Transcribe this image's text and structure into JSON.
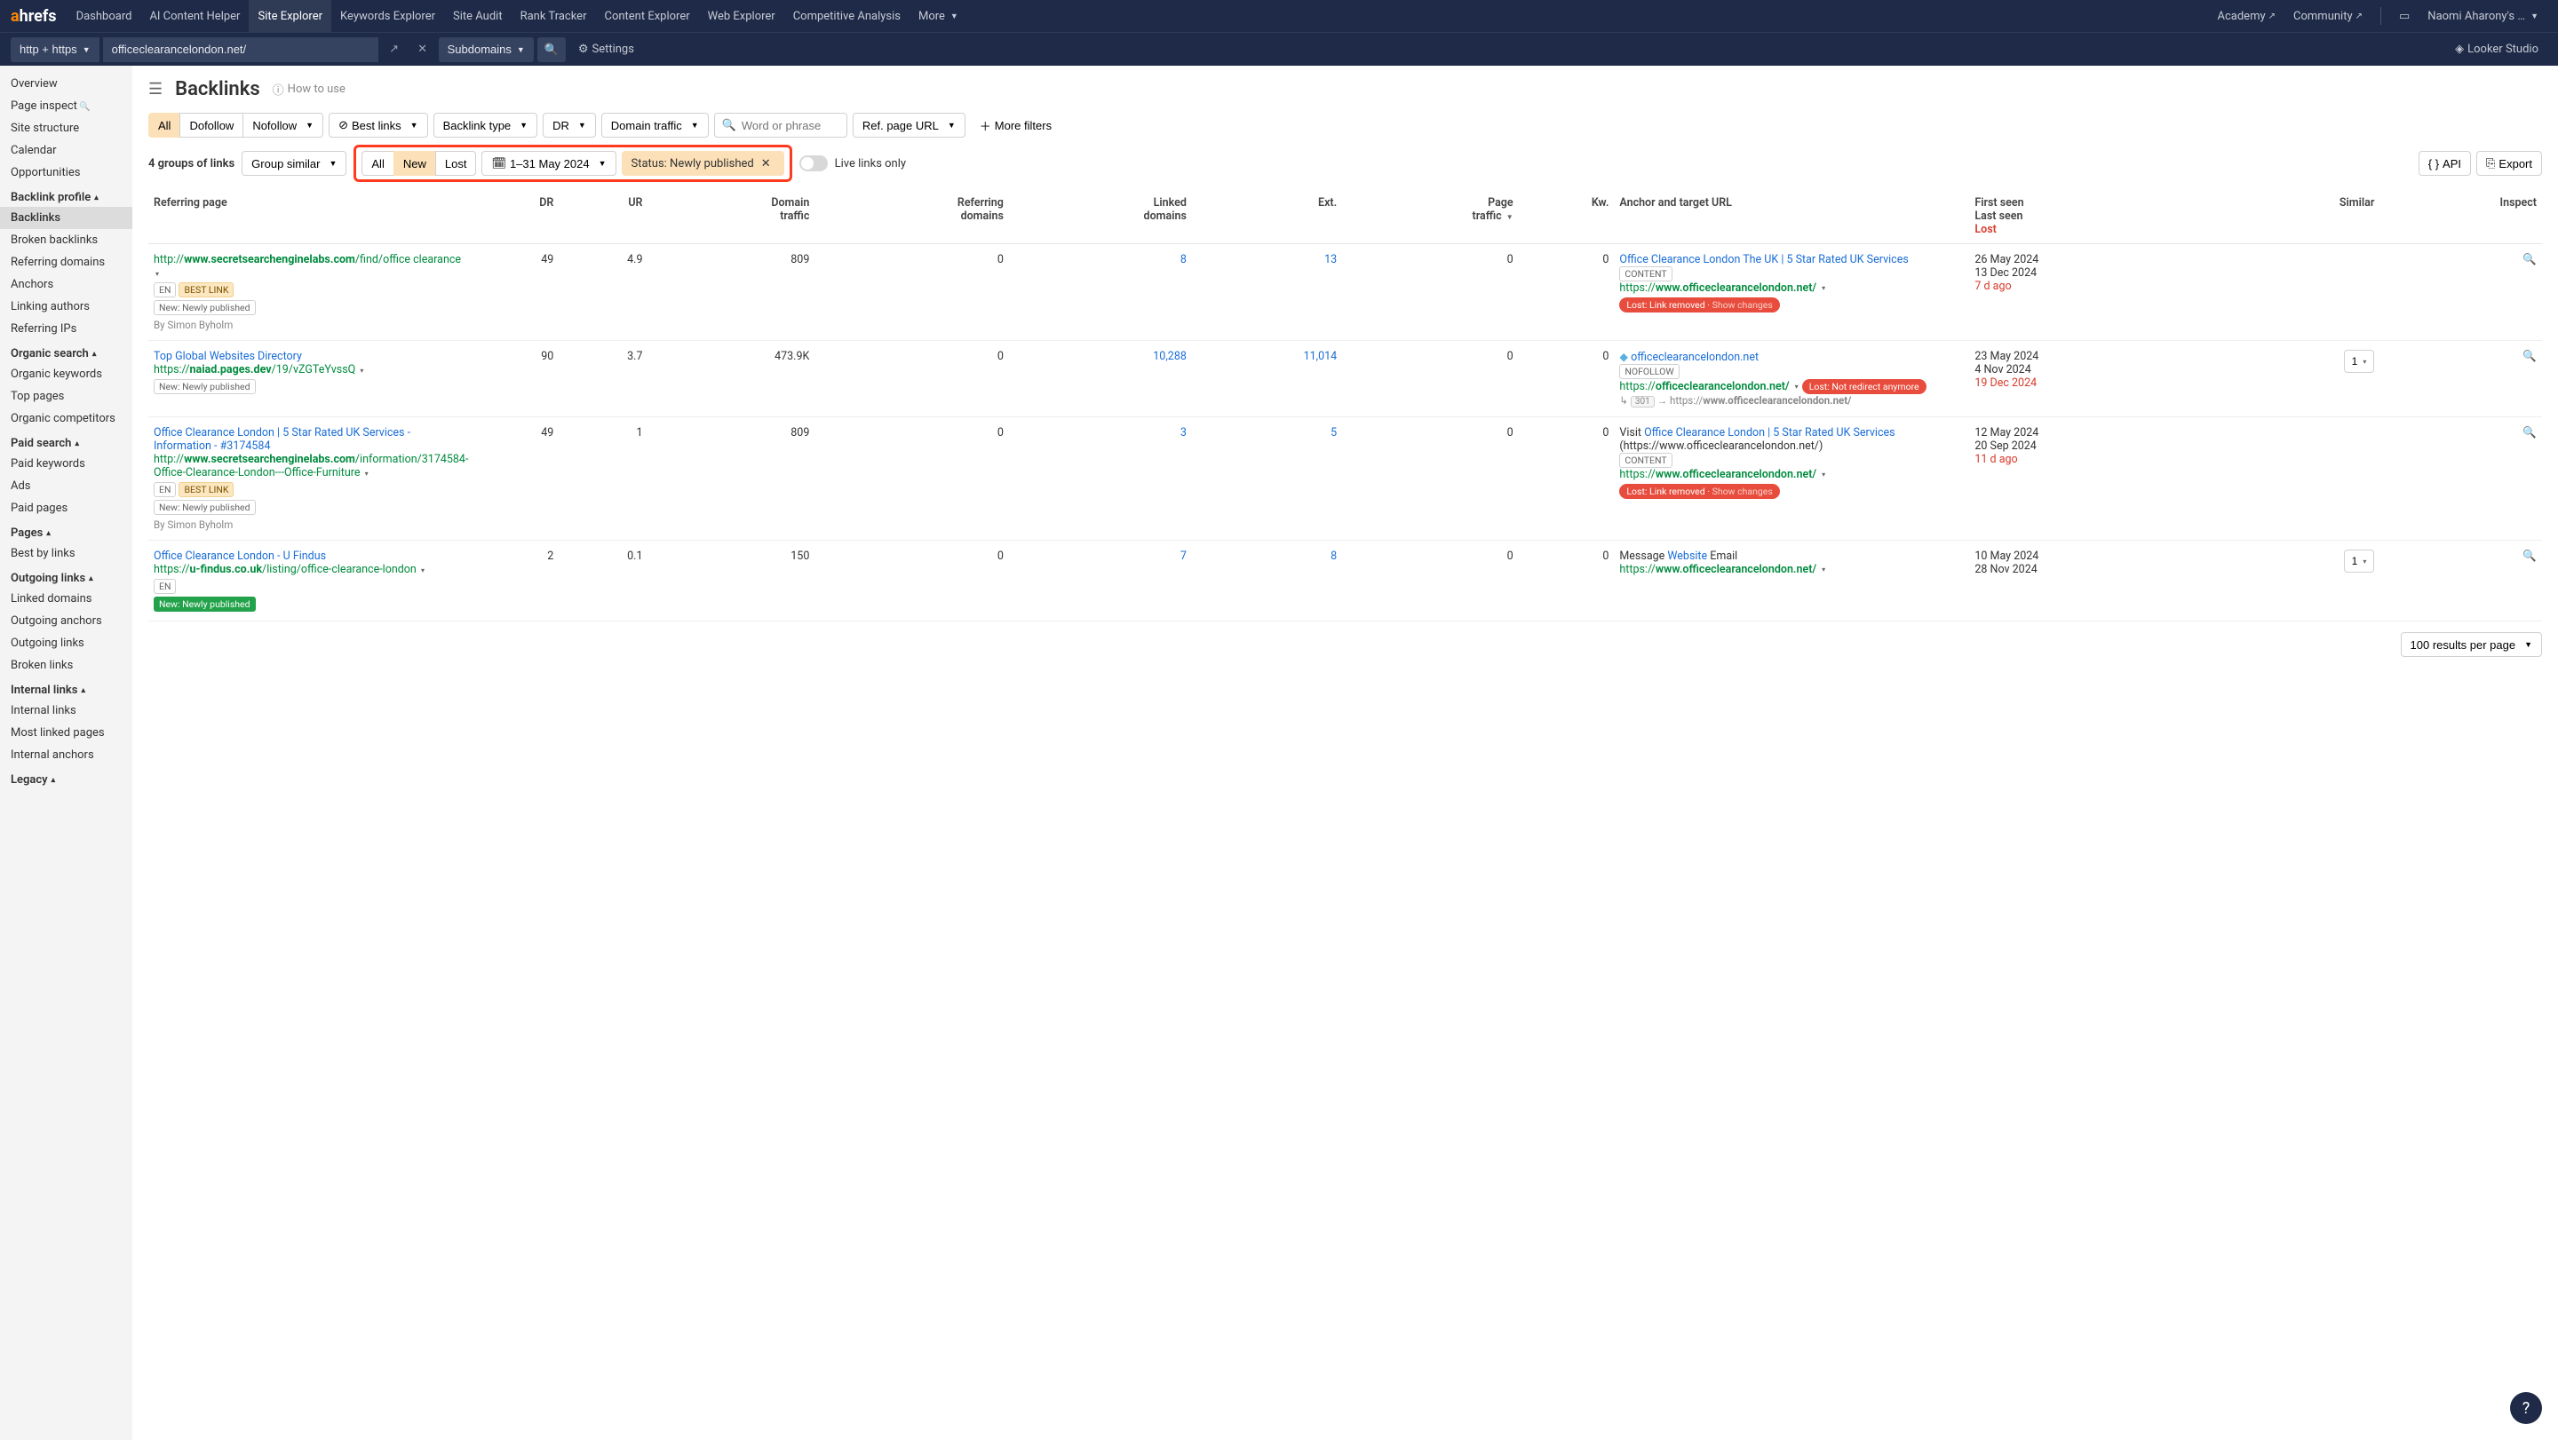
{
  "topnav": {
    "logo_pre": "a",
    "logo_rest": "hrefs",
    "items": [
      "Dashboard",
      "AI Content Helper",
      "Site Explorer",
      "Keywords Explorer",
      "Site Audit",
      "Rank Tracker",
      "Content Explorer",
      "Web Explorer",
      "Competitive Analysis",
      "More"
    ],
    "active_index": 2,
    "academy": "Academy",
    "community": "Community",
    "user": "Naomi Aharony's …"
  },
  "subbar": {
    "protocol": "http + https",
    "domain": "officeclearancelondon.net/",
    "subdomains": "Subdomains",
    "settings": "Settings",
    "looker": "Looker Studio"
  },
  "sidebar": {
    "top": [
      "Overview",
      "Page inspect",
      "Site structure",
      "Calendar",
      "Opportunities"
    ],
    "groups": [
      {
        "title": "Backlink profile",
        "items": [
          "Backlinks",
          "Broken backlinks",
          "Referring domains",
          "Anchors",
          "Linking authors",
          "Referring IPs"
        ],
        "active": "Backlinks"
      },
      {
        "title": "Organic search",
        "items": [
          "Organic keywords",
          "Top pages",
          "Organic competitors"
        ]
      },
      {
        "title": "Paid search",
        "items": [
          "Paid keywords",
          "Ads",
          "Paid pages"
        ]
      },
      {
        "title": "Pages",
        "items": [
          "Best by links"
        ]
      },
      {
        "title": "Outgoing links",
        "items": [
          "Linked domains",
          "Outgoing anchors",
          "Outgoing links",
          "Broken links"
        ]
      },
      {
        "title": "Internal links",
        "items": [
          "Internal links",
          "Most linked pages",
          "Internal anchors"
        ]
      },
      {
        "title": "Legacy",
        "items": []
      }
    ]
  },
  "header": {
    "title": "Backlinks",
    "how_to_use": "How to use"
  },
  "filters": {
    "follow": [
      "All",
      "Dofollow",
      "Nofollow"
    ],
    "follow_active": 0,
    "best_links": "Best links",
    "backlink_type": "Backlink type",
    "dr": "DR",
    "domain_traffic": "Domain traffic",
    "search_placeholder": "Word or phrase",
    "ref_page_url": "Ref. page URL",
    "more_filters": "More filters"
  },
  "subfilters": {
    "count_label": "4 groups of links",
    "group_similar": "Group similar",
    "tabs": [
      "All",
      "New",
      "Lost"
    ],
    "tabs_active": 1,
    "date_range": "1–31 May 2024",
    "status_tag": "Status: Newly published",
    "live_links": "Live links only",
    "api": "API",
    "export": "Export"
  },
  "columns": {
    "referring_page": "Referring page",
    "dr": "DR",
    "ur": "UR",
    "domain_traffic": "Domain\ntraffic",
    "referring_domains": "Referring\ndomains",
    "linked_domains": "Linked\ndomains",
    "ext": "Ext.",
    "page_traffic": "Page\ntraffic",
    "kw": "Kw.",
    "anchor": "Anchor and target URL",
    "first_seen": "First seen",
    "last_seen": "Last seen",
    "lost": "Lost",
    "similar": "Similar",
    "inspect": "Inspect"
  },
  "rows": [
    {
      "title_pre": "http://",
      "title_bold": "www.secretsearchenginelabs.com",
      "title_post": "/find/office clearance",
      "url_display": "",
      "badges": [
        {
          "t": "EN"
        },
        {
          "t": "BEST LINK",
          "hl": true
        }
      ],
      "status_badge": {
        "t": "New: Newly published",
        "green": false
      },
      "byline": "By Simon Byholm",
      "dr": "49",
      "ur": "4.9",
      "domain_traffic": "809",
      "ref_domains": "0",
      "linked_domains": "8",
      "ext": "13",
      "page_traffic": "0",
      "kw": "0",
      "anchor_text": "Office Clearance London The UK | 5 Star Rated UK Services",
      "anchor_type": "CONTENT",
      "target_url_pre": "https://",
      "target_url_bold": "www.officeclearancelondon.net/",
      "lost_pill": "Lost: Link removed",
      "lost_pill_sub": "Show changes",
      "first_seen": "26 May 2024",
      "last_seen": "13 Dec 2024",
      "lost_date": "7 d ago",
      "similar": "",
      "diamond": false,
      "nofollow": false,
      "redirect": null
    },
    {
      "title_pre": "",
      "title_bold": "Top Global Websites Directory",
      "title_post": "",
      "url_line_pre": "https://",
      "url_line_bold": "naiad.pages.dev",
      "url_line_post": "/19/vZGTeYvssQ",
      "badges": [],
      "status_badge": {
        "t": "New: Newly published",
        "green": false
      },
      "byline": "",
      "dr": "90",
      "ur": "3.7",
      "domain_traffic": "473.9K",
      "ref_domains": "0",
      "linked_domains": "10,288",
      "ext": "11,014",
      "page_traffic": "0",
      "kw": "0",
      "anchor_text": "officeclearancelondon.net",
      "anchor_type": "NOFOLLOW",
      "diamond": true,
      "target_url_pre": "https://",
      "target_url_bold": "officeclearancelondon.net/",
      "lost_pill": "",
      "lost_inline": "Lost: Not redirect anymore",
      "redirect": {
        "code": "301",
        "to_pre": "https://",
        "to_bold": "www.officeclearancelondon.net/"
      },
      "first_seen": "23 May 2024",
      "last_seen": "4 Nov 2024",
      "lost_date": "19 Dec 2024",
      "similar": "1"
    },
    {
      "title_pre": "",
      "title_bold": "Office Clearance London | 5 Star Rated UK Services - Information - #3174584",
      "title_post": "",
      "url_line_pre": "http://",
      "url_line_bold": "www.secretsearchenginelabs.com",
      "url_line_post": "/information/3174584-Office-Clearance-London---Office-Furniture",
      "badges": [
        {
          "t": "EN"
        },
        {
          "t": "BEST LINK",
          "hl": true
        }
      ],
      "status_badge": {
        "t": "New: Newly published",
        "green": false
      },
      "byline": "By Simon Byholm",
      "dr": "49",
      "ur": "1",
      "domain_traffic": "809",
      "ref_domains": "0",
      "linked_domains": "3",
      "ext": "5",
      "page_traffic": "0",
      "kw": "0",
      "anchor_prefix": "Visit ",
      "anchor_text": "Office Clearance London | 5 Star Rated UK Services",
      "anchor_suffix": " (https://www.officeclearancelondon.net/)",
      "anchor_type": "CONTENT",
      "target_url_pre": "https://",
      "target_url_bold": "www.officeclearancelondon.net/",
      "lost_pill": "Lost: Link removed",
      "lost_pill_sub": "Show changes",
      "first_seen": "12 May 2024",
      "last_seen": "20 Sep 2024",
      "lost_date": "11 d ago",
      "similar": "",
      "diamond": false,
      "redirect": null
    },
    {
      "title_pre": "",
      "title_bold": "Office Clearance London - U Findus",
      "title_post": "",
      "url_line_pre": "https://",
      "url_line_bold": "u-findus.co.uk",
      "url_line_post": "/listing/office-clearance-london",
      "badges": [
        {
          "t": "EN"
        }
      ],
      "status_badge": {
        "t": "New: Newly published",
        "green": true
      },
      "byline": "",
      "dr": "2",
      "ur": "0.1",
      "domain_traffic": "150",
      "ref_domains": "0",
      "linked_domains": "7",
      "ext": "8",
      "page_traffic": "0",
      "kw": "0",
      "anchor_prefix": "Message ",
      "anchor_text": "Website",
      "anchor_suffix": " Email",
      "anchor_type": "",
      "target_url_pre": "https://",
      "target_url_bold": "www.officeclearancelondon.net/",
      "lost_pill": "",
      "first_seen": "10 May 2024",
      "last_seen": "28 Nov 2024",
      "lost_date": "",
      "similar": "1",
      "diamond": false,
      "redirect": null
    }
  ],
  "footer": {
    "results_per_page": "100 results per page"
  }
}
